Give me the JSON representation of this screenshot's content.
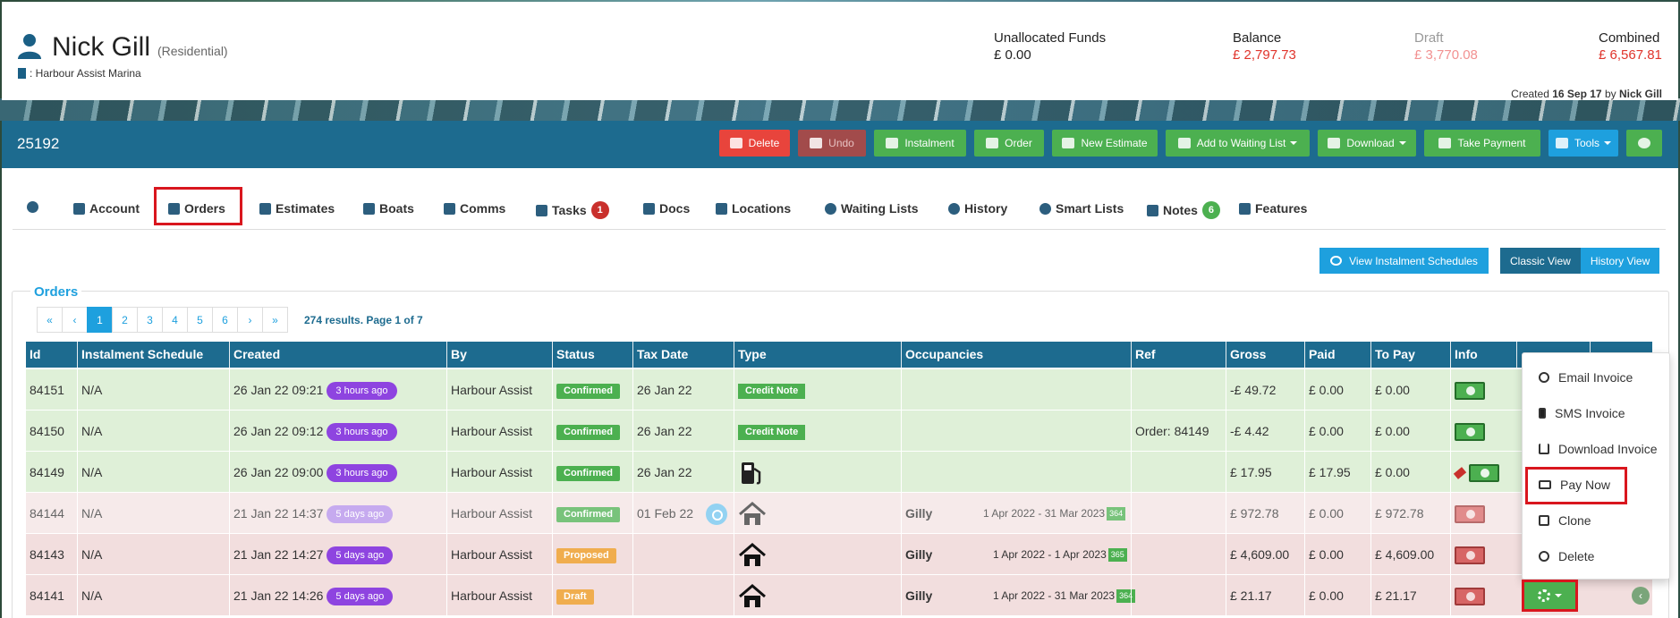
{
  "customer": {
    "name": "Nick Gill",
    "type": "(Residential)",
    "marina": ": Harbour Assist Marina"
  },
  "funds": {
    "unallocated_label": "Unallocated Funds",
    "unallocated_value": "£ 0.00",
    "balance_label": "Balance",
    "balance_value": "£ 2,797.73",
    "draft_label": "Draft",
    "draft_value": "£ 3,770.08",
    "combined_label": "Combined",
    "combined_value": "£ 6,567.81"
  },
  "created": {
    "prefix": "Created",
    "date": "16 Sep 17",
    "by": "by",
    "user": "Nick Gill"
  },
  "toolbar": {
    "record_id": "25192",
    "delete": "Delete",
    "undo": "Undo",
    "instalment": "Instalment",
    "order": "Order",
    "new_estimate": "New Estimate",
    "add_waiting": "Add to Waiting List",
    "download": "Download",
    "take_payment": "Take Payment",
    "tools": "Tools"
  },
  "tabs": {
    "account": "Account",
    "orders": "Orders",
    "estimates": "Estimates",
    "boats": "Boats",
    "comms": "Comms",
    "tasks": "Tasks",
    "tasks_count": "1",
    "docs": "Docs",
    "locations": "Locations",
    "waiting": "Waiting Lists",
    "history": "History",
    "smart": "Smart Lists",
    "notes": "Notes",
    "notes_count": "6",
    "features": "Features"
  },
  "actions": {
    "view_schedules": "View Instalment Schedules",
    "classic_view": "Classic View",
    "history_view": "History View"
  },
  "orders": {
    "title": "Orders",
    "pager": [
      "«",
      "‹",
      "1",
      "2",
      "3",
      "4",
      "5",
      "6",
      "›",
      "»"
    ],
    "results": "274 results. Page 1 of 7",
    "headers": [
      "Id",
      "Instalment Schedule",
      "Created",
      "By",
      "Status",
      "Tax Date",
      "Type",
      "Occupancies",
      "Ref",
      "Gross",
      "Paid",
      "To Pay",
      "Info"
    ],
    "rows": [
      {
        "id": "84151",
        "sched": "N/A",
        "created": "26 Jan 22 09:21",
        "ago": "3 hours ago",
        "by": "Harbour Assist",
        "status": "Confirmed",
        "tax": "26 Jan 22",
        "type": "Credit Note",
        "occ_name": "",
        "occ_dates": "",
        "occ_days": "",
        "ref": "",
        "gross": "-£ 49.72",
        "paid": "£ 0.00",
        "topay": "£ 0.00"
      },
      {
        "id": "84150",
        "sched": "N/A",
        "created": "26 Jan 22 09:12",
        "ago": "3 hours ago",
        "by": "Harbour Assist",
        "status": "Confirmed",
        "tax": "26 Jan 22",
        "type": "Credit Note",
        "occ_name": "",
        "occ_dates": "",
        "occ_days": "",
        "ref": "Order: 84149",
        "gross": "-£ 4.42",
        "paid": "£ 0.00",
        "topay": "£ 0.00"
      },
      {
        "id": "84149",
        "sched": "N/A",
        "created": "26 Jan 22 09:00",
        "ago": "3 hours ago",
        "by": "Harbour Assist",
        "status": "Confirmed",
        "tax": "26 Jan 22",
        "type": "",
        "occ_name": "",
        "occ_dates": "",
        "occ_days": "",
        "ref": "",
        "gross": "£ 17.95",
        "paid": "£ 17.95",
        "topay": "£ 0.00"
      },
      {
        "id": "84144",
        "sched": "N/A",
        "created": "21 Jan 22 14:37",
        "ago": "5 days ago",
        "by": "Harbour Assist",
        "status": "Confirmed",
        "tax": "01 Feb 22",
        "type": "",
        "occ_name": "Gilly",
        "occ_dates": "1 Apr 2022 - 31 Mar 2023",
        "occ_days": "364",
        "ref": "",
        "gross": "£ 972.78",
        "paid": "£ 0.00",
        "topay": "£ 972.78"
      },
      {
        "id": "84143",
        "sched": "N/A",
        "created": "21 Jan 22 14:27",
        "ago": "5 days ago",
        "by": "Harbour Assist",
        "status": "Proposed",
        "tax": "",
        "type": "",
        "occ_name": "Gilly",
        "occ_dates": "1 Apr 2022 - 1 Apr 2023",
        "occ_days": "365",
        "ref": "",
        "gross": "£ 4,609.00",
        "paid": "£ 0.00",
        "topay": "£ 4,609.00"
      },
      {
        "id": "84141",
        "sched": "N/A",
        "created": "21 Jan 22 14:26",
        "ago": "5 days ago",
        "by": "Harbour Assist",
        "status": "Draft",
        "tax": "",
        "type": "",
        "occ_name": "Gilly",
        "occ_dates": "1 Apr 2022 - 31 Mar 2023",
        "occ_days": "364",
        "ref": "",
        "gross": "£ 21.17",
        "paid": "£ 0.00",
        "topay": "£ 21.17"
      }
    ]
  },
  "dropdown": {
    "email": "Email Invoice",
    "sms": "SMS Invoice",
    "download": "Download Invoice",
    "pay_now": "Pay Now",
    "clone": "Clone",
    "delete": "Delete"
  },
  "colors": {
    "header_blue": "#1d6b8f",
    "accent_blue": "#1ea0de",
    "green": "#4cb050",
    "red": "#e8443c",
    "highlight": "#d9161e"
  }
}
